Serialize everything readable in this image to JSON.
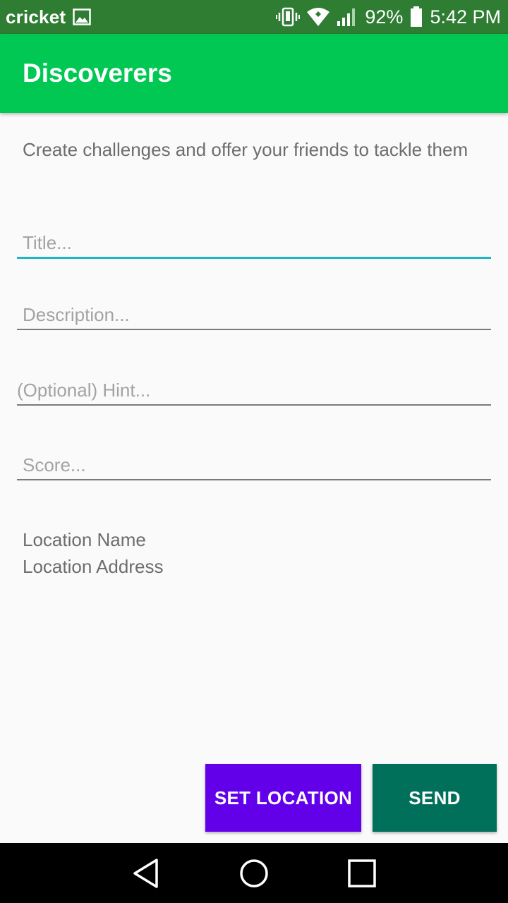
{
  "status_bar": {
    "carrier": "cricket",
    "battery": "92%",
    "time": "5:42 PM"
  },
  "app_bar": {
    "title": "Discoverers"
  },
  "intro_text": "Create challenges and offer your friends to tackle them",
  "form": {
    "title_placeholder": "Title...",
    "description_placeholder": "Description...",
    "hint_placeholder": "(Optional) Hint...",
    "score_placeholder": "Score..."
  },
  "location": {
    "name": "Location Name",
    "address": "Location Address"
  },
  "buttons": {
    "set_location": "SET LOCATION",
    "send": "SEND"
  },
  "colors": {
    "status_bar": "#2e7d32",
    "app_bar": "#00c853",
    "focus_underline": "#1eb6c4",
    "set_location_button": "#6200ea",
    "send_button": "#00705a"
  }
}
